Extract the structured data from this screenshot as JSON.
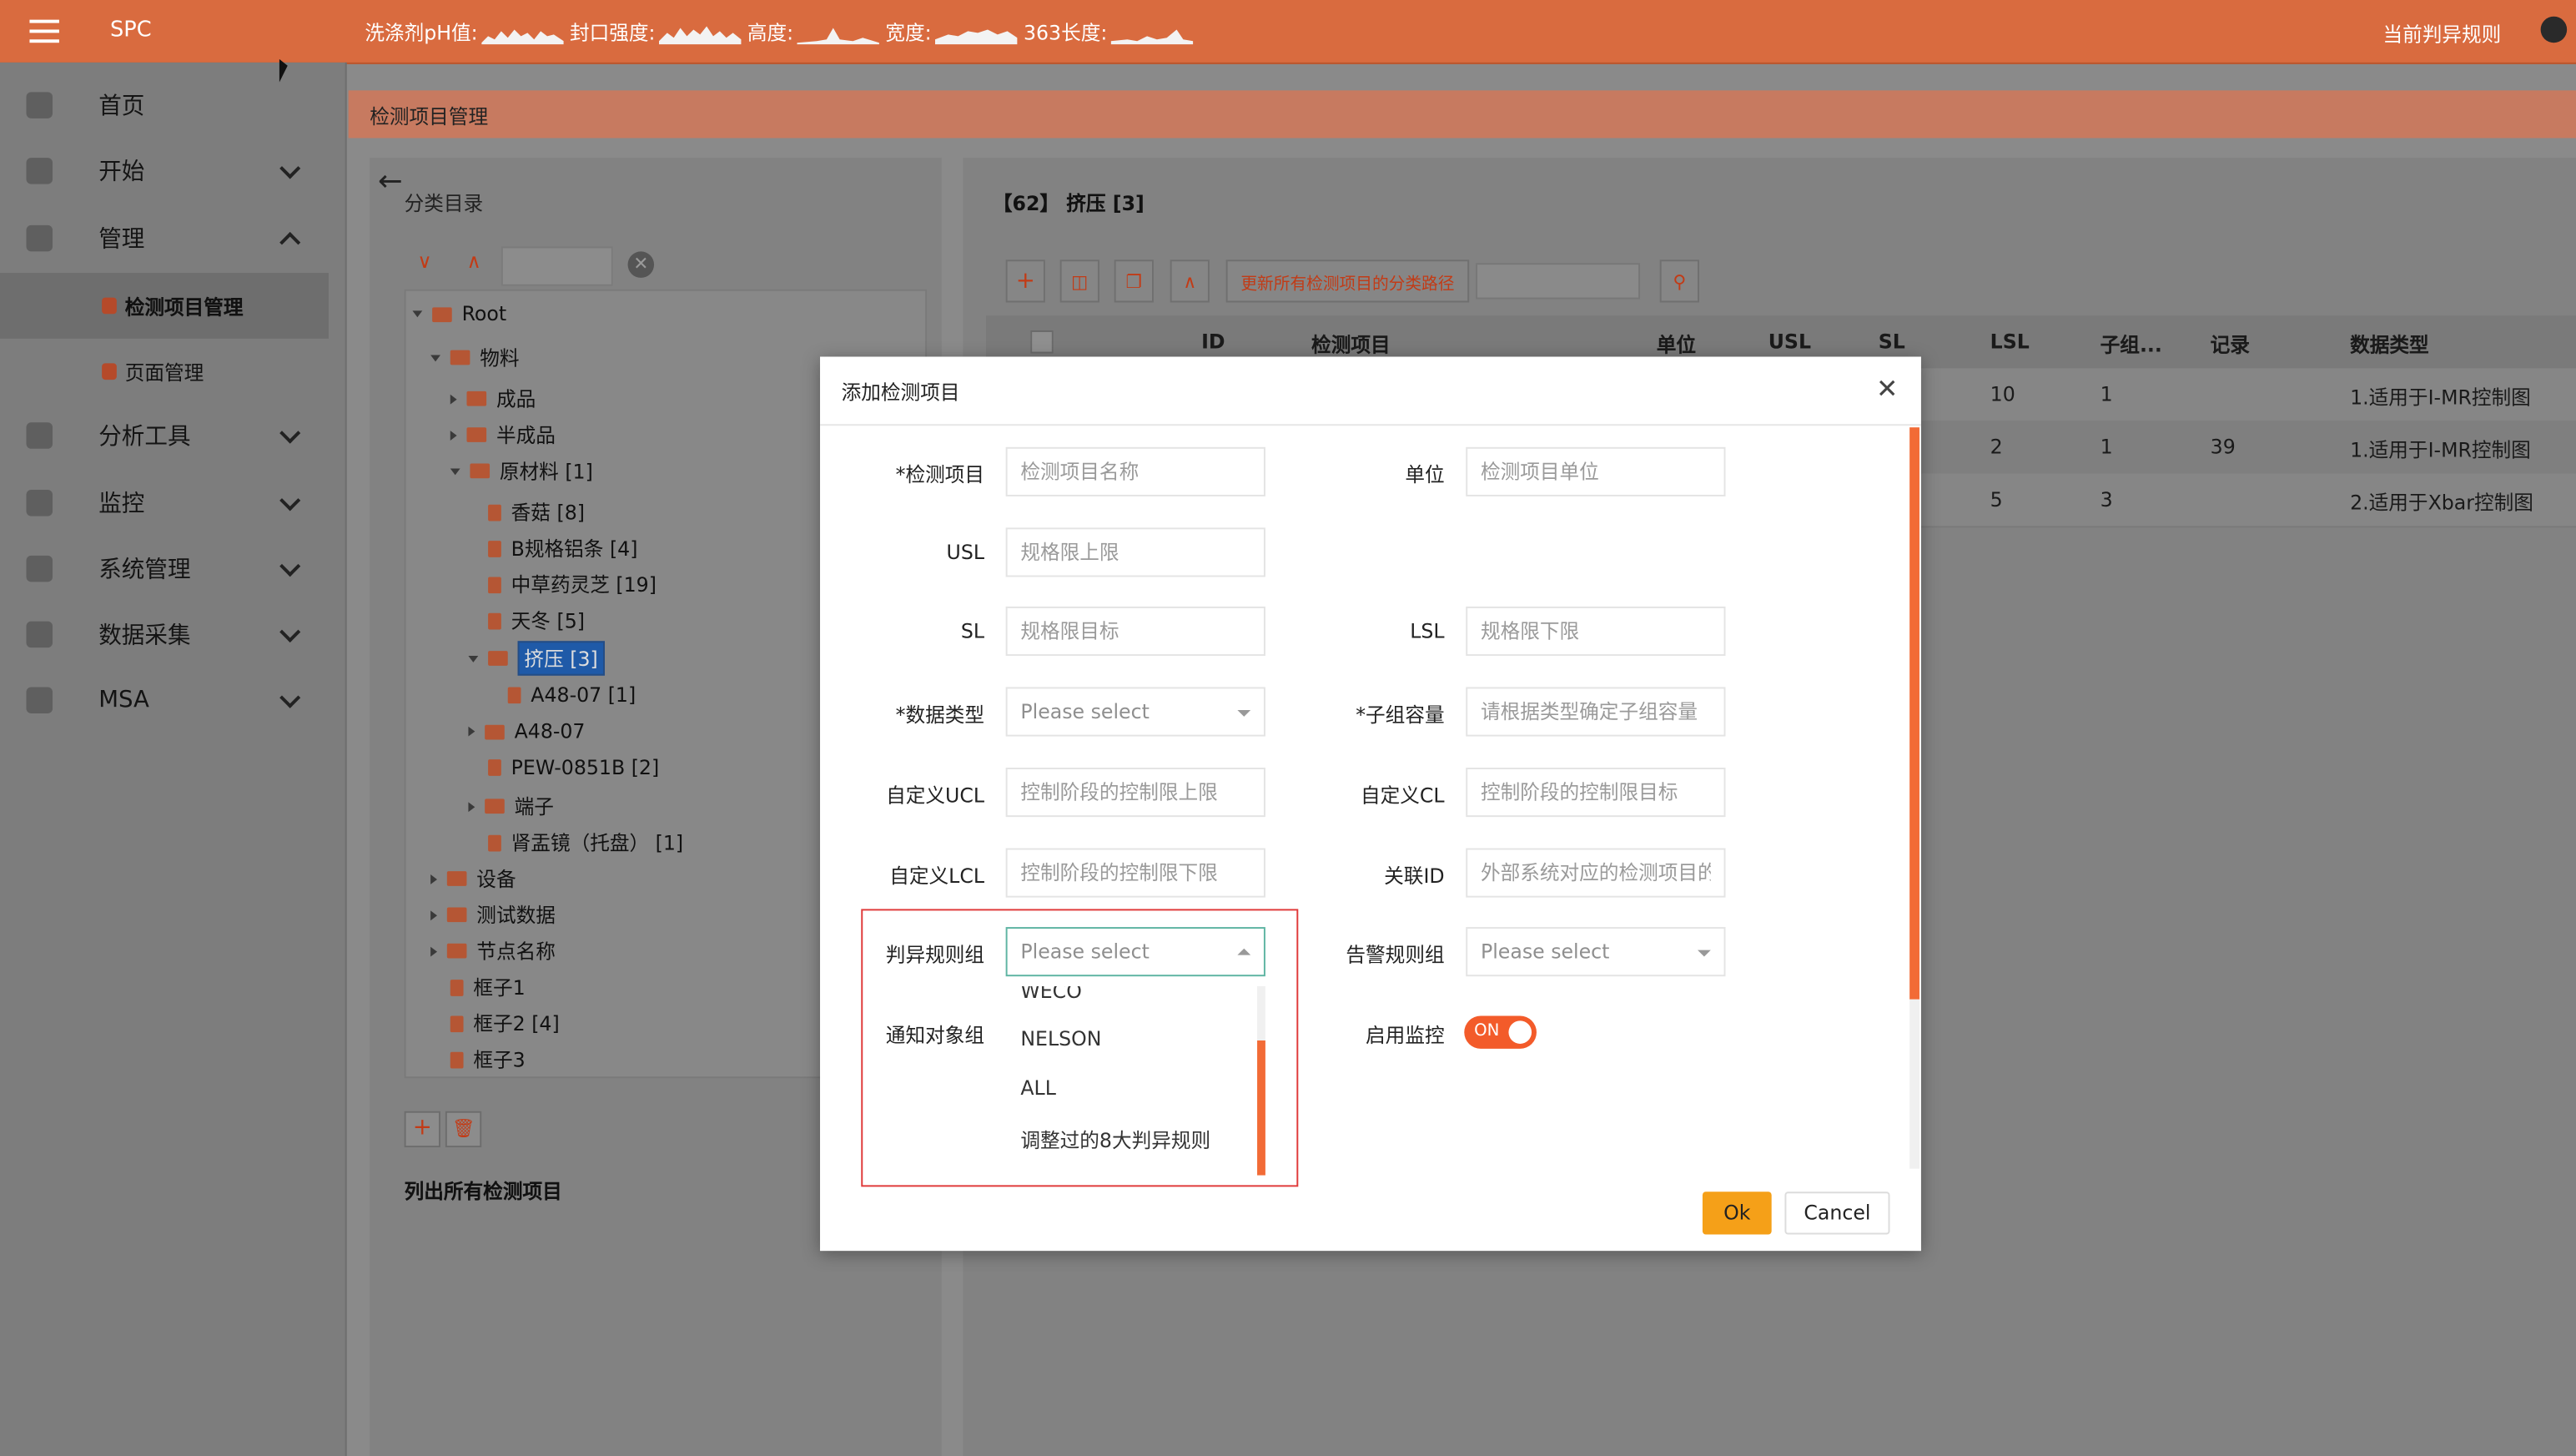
{
  "topbar": {
    "brand": "SPC",
    "metrics": [
      {
        "label": "洗涤剂pH值:"
      },
      {
        "label": "封口强度:"
      },
      {
        "label": "高度:"
      },
      {
        "label": "宽度:"
      },
      {
        "label": "363长度:"
      }
    ],
    "right_link": "当前判异规则"
  },
  "sidebar": {
    "items": [
      {
        "label": "首页",
        "icon": "home-icon"
      },
      {
        "label": "开始",
        "icon": "paper-plane-icon"
      },
      {
        "label": "管理",
        "icon": "gear-icon"
      },
      {
        "label": "分析工具",
        "icon": "analysis-icon"
      },
      {
        "label": "监控",
        "icon": "monitor-icon"
      },
      {
        "label": "系统管理",
        "icon": "system-icon"
      },
      {
        "label": "数据采集",
        "icon": "data-collection-icon"
      },
      {
        "label": "MSA",
        "icon": "msa-icon"
      }
    ],
    "subitems": [
      {
        "label": "检测项目管理"
      },
      {
        "label": "页面管理"
      }
    ]
  },
  "breadcrumb": "检测项目管理",
  "left_panel": {
    "title": "分类目录",
    "tree": [
      {
        "label": "Root"
      },
      {
        "label": "物料"
      },
      {
        "label": "成品"
      },
      {
        "label": "半成品"
      },
      {
        "label": "原材料 [1]"
      },
      {
        "label": "香菇 [8]"
      },
      {
        "label": "B规格铝条 [4]"
      },
      {
        "label": "中草药灵芝 [19]"
      },
      {
        "label": "天冬 [5]"
      },
      {
        "label": "挤压 [3]"
      },
      {
        "label": "A48-07 [1]"
      },
      {
        "label": "A48-07"
      },
      {
        "label": "PEW-0851B [2]"
      },
      {
        "label": "端子"
      },
      {
        "label": "肾盂镜（托盘） [1]"
      },
      {
        "label": "设备"
      },
      {
        "label": "测试数据"
      },
      {
        "label": "节点名称"
      },
      {
        "label": "框子1"
      },
      {
        "label": "框子2 [4]"
      },
      {
        "label": "框子3"
      }
    ],
    "list_all": "列出所有检测项目"
  },
  "right_panel": {
    "title": "【62】 挤压 [3]",
    "update_path_btn": "更新所有检测项目的分类路径",
    "columns": [
      "ID",
      "检测项目",
      "单位",
      "USL",
      "SL",
      "LSL",
      "子组...",
      "记录",
      "数据类型"
    ],
    "rows": [
      {
        "lsl": "10",
        "sub": "1",
        "rec": "",
        "type": "1.适用于I-MR控制图"
      },
      {
        "lsl": "2",
        "sub": "1",
        "rec": "39",
        "type": "1.适用于I-MR控制图"
      },
      {
        "lsl": "5",
        "sub": "3",
        "rec": "",
        "type": "2.适用于Xbar控制图"
      }
    ]
  },
  "modal": {
    "title": "添加检测项目",
    "fields": {
      "item": {
        "label": "*检测项目",
        "placeholder": "检测项目名称"
      },
      "unit": {
        "label": "单位",
        "placeholder": "检测项目单位"
      },
      "usl": {
        "label": "USL",
        "placeholder": "规格限上限"
      },
      "sl": {
        "label": "SL",
        "placeholder": "规格限目标"
      },
      "lsl": {
        "label": "LSL",
        "placeholder": "规格限下限"
      },
      "dtype": {
        "label": "*数据类型",
        "value": "Please select"
      },
      "subgroup": {
        "label": "*子组容量",
        "placeholder": "请根据类型确定子组容量"
      },
      "ucl": {
        "label": "自定义UCL",
        "placeholder": "控制阶段的控制限上限"
      },
      "cl": {
        "label": "自定义CL",
        "placeholder": "控制阶段的控制限目标"
      },
      "lcl": {
        "label": "自定义LCL",
        "placeholder": "控制阶段的控制限下限"
      },
      "link_id": {
        "label": "关联ID",
        "placeholder": "外部系统对应的检测项目的唯"
      },
      "rule_group": {
        "label": "判异规则组",
        "value": "Please select"
      },
      "alarm_group": {
        "label": "告警规则组",
        "value": "Please select"
      },
      "notify_group": {
        "label": "通知对象组"
      },
      "monitor": {
        "label": "启用监控",
        "state": "ON"
      }
    },
    "dropdown_options": [
      "WECO",
      "NELSON",
      "ALL",
      "调整过的8大判异规则"
    ],
    "ok": "Ok",
    "cancel": "Cancel"
  },
  "colors": {
    "topbar": "#d96b3f",
    "accent": "#f35b2a",
    "ok_button": "#f5a018",
    "highlight_box": "#e03a3a"
  }
}
